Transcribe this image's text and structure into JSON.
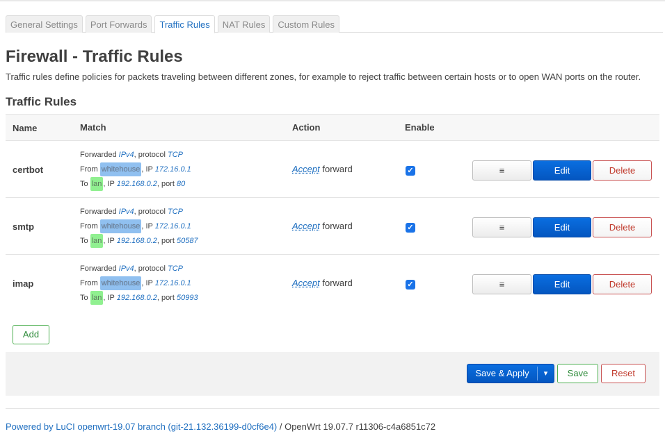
{
  "tabs": [
    "General Settings",
    "Port Forwards",
    "Traffic Rules",
    "NAT Rules",
    "Custom Rules"
  ],
  "active_tab": 2,
  "page": {
    "title": "Firewall - Traffic Rules",
    "description": "Traffic rules define policies for packets traveling between different zones, for example to reject traffic between certain hosts or to open WAN ports on the router.",
    "section_title": "Traffic Rules"
  },
  "table": {
    "headers": {
      "name": "Name",
      "match": "Match",
      "action": "Action",
      "enable": "Enable"
    },
    "rows": [
      {
        "name": "certbot",
        "l1_pre": "Forwarded ",
        "family": "IPv4",
        "l1_mid": ", protocol ",
        "proto": "TCP",
        "l2_pre": "From ",
        "src_zone": "whitehouse",
        "l2_mid": ", IP ",
        "src_ip": "172.16.0.1",
        "l3_pre": "To ",
        "dest_zone": "lan",
        "l3_mid": ", IP ",
        "dest_ip": "192.168.0.2",
        "l3_port": ", port ",
        "port": "80",
        "action": "Accept",
        "action_suffix": " forward",
        "enabled": true
      },
      {
        "name": "smtp",
        "l1_pre": "Forwarded ",
        "family": "IPv4",
        "l1_mid": ", protocol ",
        "proto": "TCP",
        "l2_pre": "From ",
        "src_zone": "whitehouse",
        "l2_mid": ", IP ",
        "src_ip": "172.16.0.1",
        "l3_pre": "To ",
        "dest_zone": "lan",
        "l3_mid": ", IP ",
        "dest_ip": "192.168.0.2",
        "l3_port": ", port ",
        "port": "50587",
        "action": "Accept",
        "action_suffix": " forward",
        "enabled": true
      },
      {
        "name": "imap",
        "l1_pre": "Forwarded ",
        "family": "IPv4",
        "l1_mid": ", protocol ",
        "proto": "TCP",
        "l2_pre": "From ",
        "src_zone": "whitehouse",
        "l2_mid": ", IP ",
        "src_ip": "172.16.0.1",
        "l3_pre": "To ",
        "dest_zone": "lan",
        "l3_mid": ", IP ",
        "dest_ip": "192.168.0.2",
        "l3_port": ", port ",
        "port": "50993",
        "action": "Accept",
        "action_suffix": " forward",
        "enabled": true
      }
    ],
    "buttons": {
      "drag": "≡",
      "edit": "Edit",
      "delete": "Delete"
    }
  },
  "add_label": "Add",
  "footer_actions": {
    "save_apply": "Save & Apply",
    "save_apply_drop_icon": "▾",
    "save": "Save",
    "reset": "Reset"
  },
  "footer": {
    "link": "Powered by LuCI openwrt-19.07 branch (git-21.132.36199-d0cf6e4)",
    "text": " / OpenWrt 19.07.7 r11306-c4a6851c72"
  },
  "colors": {
    "accent": "#1f6fc0",
    "wan_zone": "#90c0f0",
    "lan_zone": "#90f090",
    "delete": "#c0392b",
    "save": "#2e8b3a"
  }
}
